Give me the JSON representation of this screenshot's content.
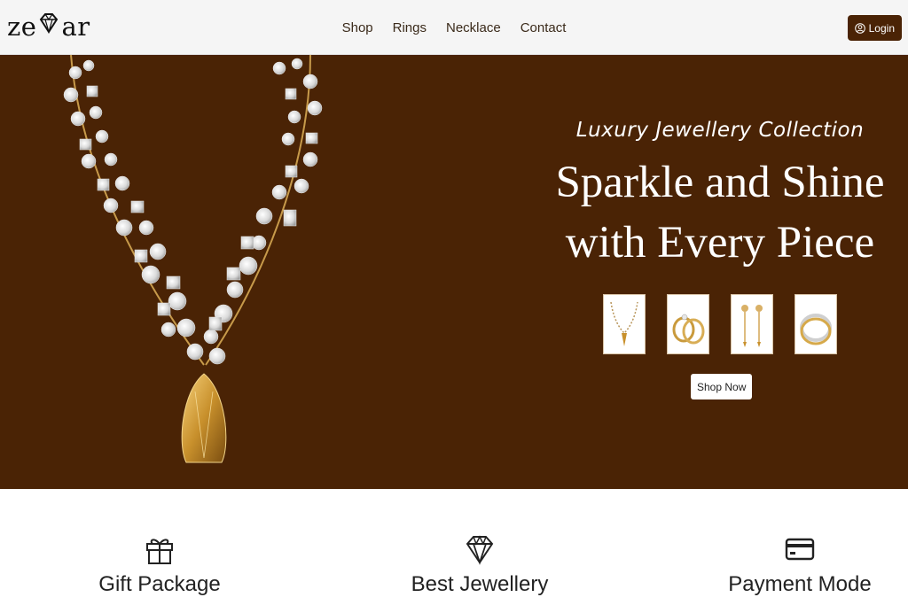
{
  "brand": {
    "name_left": "ze",
    "name_right": "ar",
    "logo_icon": "diamond-icon"
  },
  "nav": {
    "items": [
      {
        "label": "Shop"
      },
      {
        "label": "Rings"
      },
      {
        "label": "Necklace"
      },
      {
        "label": "Contact"
      }
    ]
  },
  "login": {
    "label": "Login",
    "icon": "user-circle-icon"
  },
  "hero": {
    "subtitle": "Luxury Jewellery Collection",
    "title_line1": "Sparkle and Shine",
    "title_line2": "with Every Piece",
    "thumbnails": [
      {
        "icon": "necklace-icon"
      },
      {
        "icon": "rings-icon"
      },
      {
        "icon": "earrings-icon"
      },
      {
        "icon": "bangles-icon"
      }
    ],
    "cta": "Shop Now"
  },
  "features": [
    {
      "label": "Gift Package",
      "icon": "gift-icon"
    },
    {
      "label": "Best Jewellery",
      "icon": "diamond-icon"
    },
    {
      "label": "Payment Mode",
      "icon": "credit-card-icon"
    }
  ],
  "colors": {
    "accent": "#4a2305",
    "nav_bg": "#f5f5f5",
    "gold": "#d6a94a"
  }
}
